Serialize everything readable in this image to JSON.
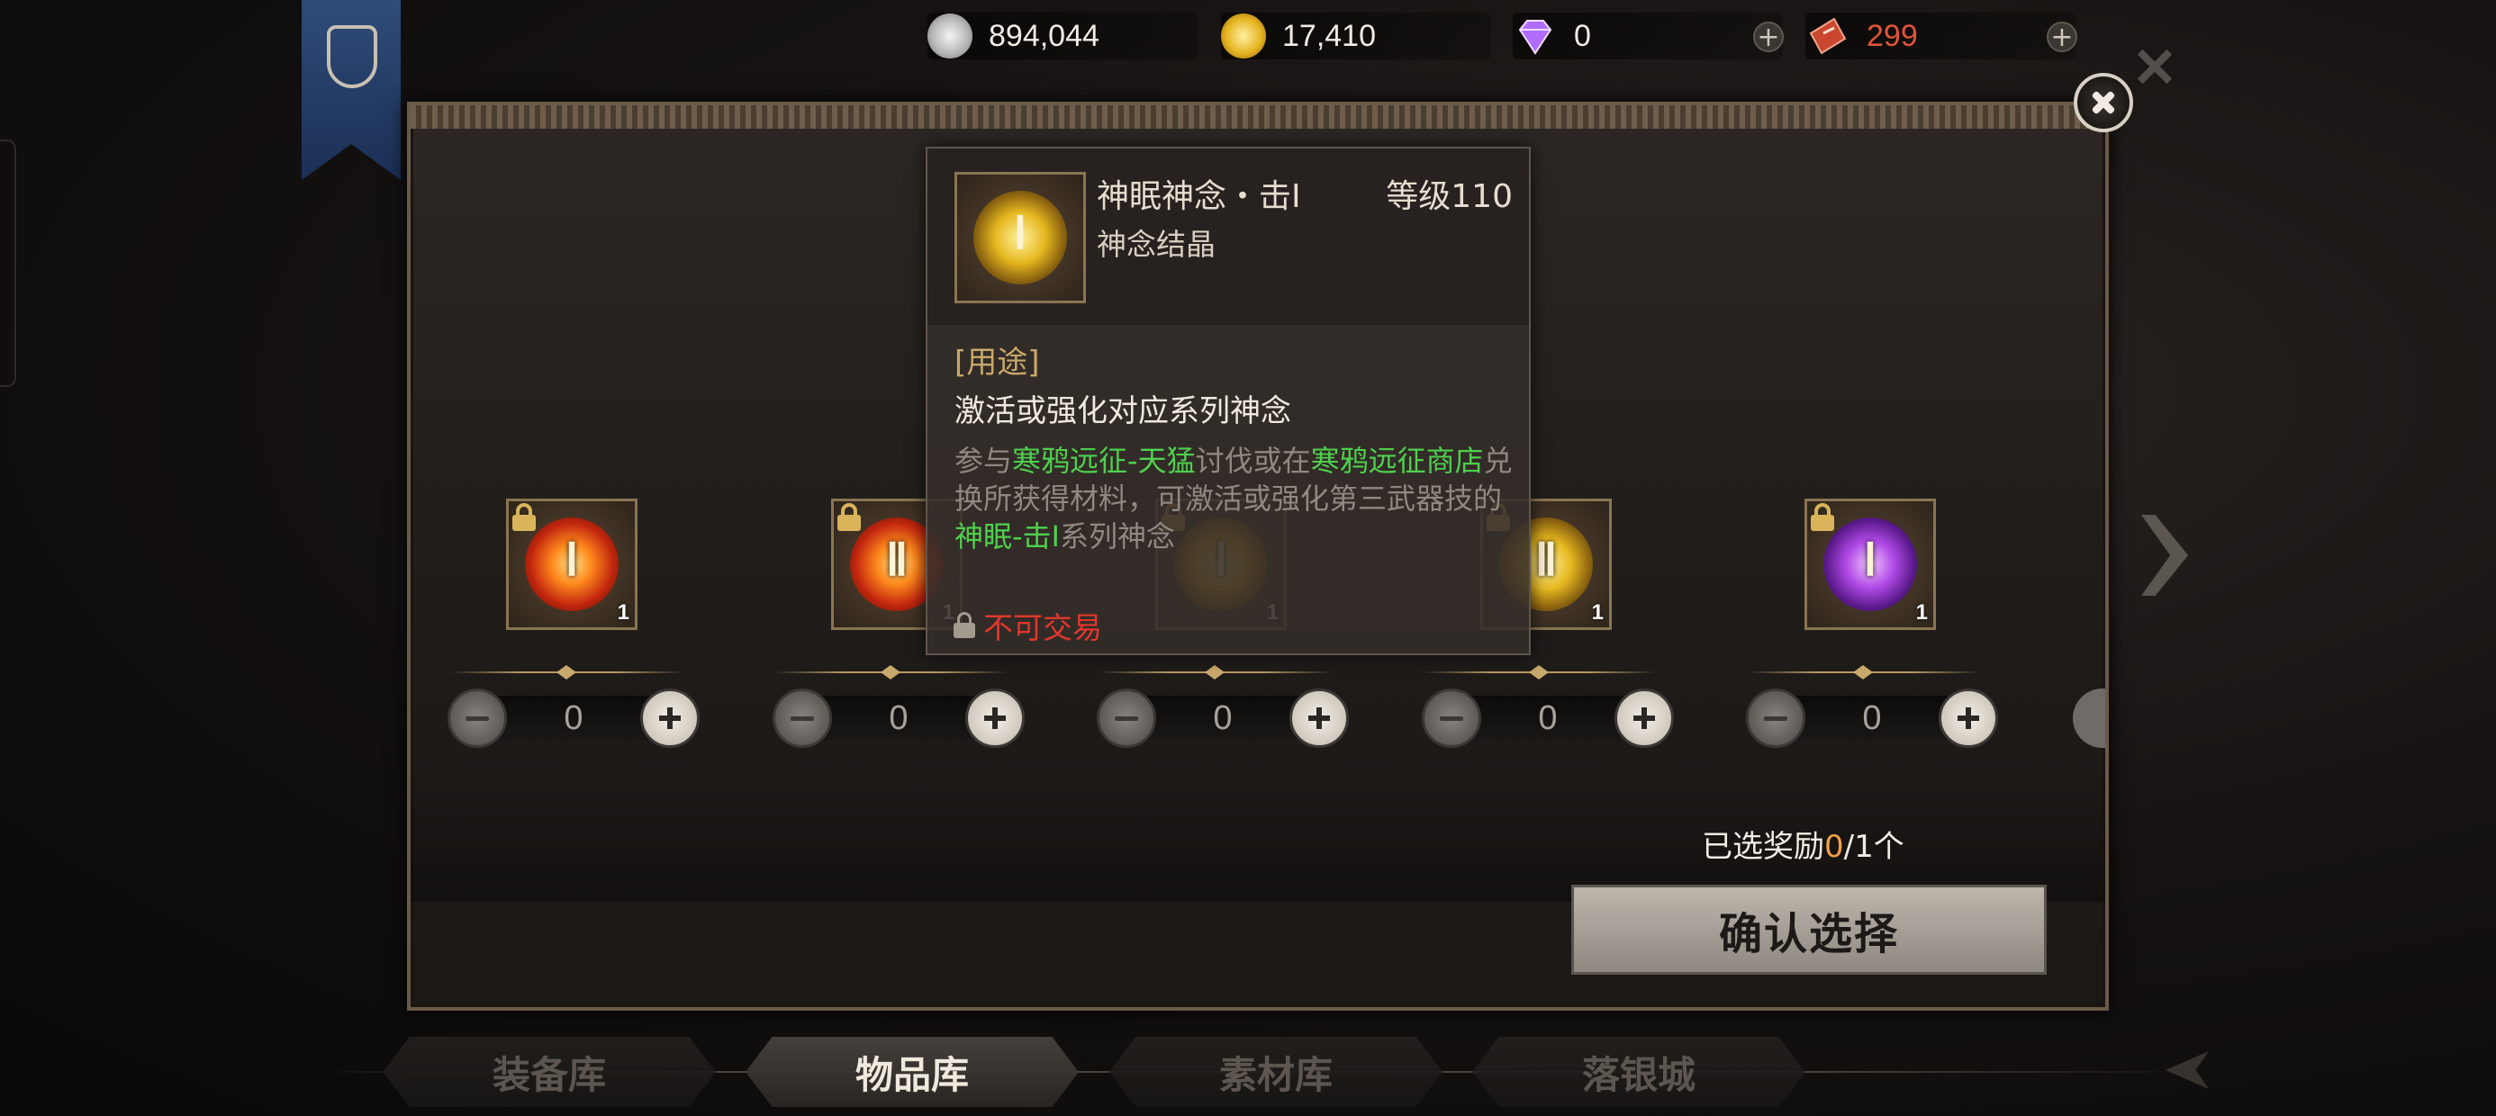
{
  "currencies": [
    {
      "name": "silver",
      "value": "894,044",
      "color": "#c9c9c9"
    },
    {
      "name": "gold",
      "value": "17,410",
      "color": "#e6b422"
    },
    {
      "name": "diamond",
      "value": "0",
      "color": "#b06cff"
    },
    {
      "name": "ticket",
      "value": "299",
      "color": "#e0543a"
    }
  ],
  "panel": {
    "items": [
      {
        "roman": "Ⅰ",
        "count": "1",
        "quantity": "0",
        "orb": "red",
        "locked": true
      },
      {
        "roman": "Ⅱ",
        "count": "1",
        "quantity": "0",
        "orb": "red",
        "locked": true
      },
      {
        "roman": "Ⅰ",
        "count": "1",
        "quantity": "0",
        "orb": "gold",
        "locked": true
      },
      {
        "roman": "Ⅱ",
        "count": "1",
        "quantity": "0",
        "orb": "gold",
        "locked": true
      },
      {
        "roman": "Ⅰ",
        "count": "1",
        "quantity": "0",
        "orb": "purple",
        "locked": true
      }
    ],
    "selected_prefix": "已选奖励",
    "selected_count": "0",
    "selected_suffix": "/1个",
    "confirm_label": "确认选择"
  },
  "tooltip": {
    "icon_roman": "Ⅰ",
    "name": "神眠神念・击Ⅰ",
    "level": "等级110",
    "type": "神念结晶",
    "section_label": "[用途]",
    "usage": "激活或强化对应系列神念",
    "desc_1": "参与",
    "desc_link_1": "寒鸦远征-天猛",
    "desc_2": "讨伐或在",
    "desc_link_2": "寒鸦远征商店",
    "desc_3": "兑换所获得材料，可激活或强化第三武器技的",
    "desc_link_3": "神眠-击Ⅰ",
    "desc_4": "系列神念",
    "trade_status": "不可交易"
  },
  "tabs": [
    {
      "label": "装备库",
      "active": false
    },
    {
      "label": "物品库",
      "active": true
    },
    {
      "label": "素材库",
      "active": false
    },
    {
      "label": "落银城",
      "active": false
    }
  ]
}
